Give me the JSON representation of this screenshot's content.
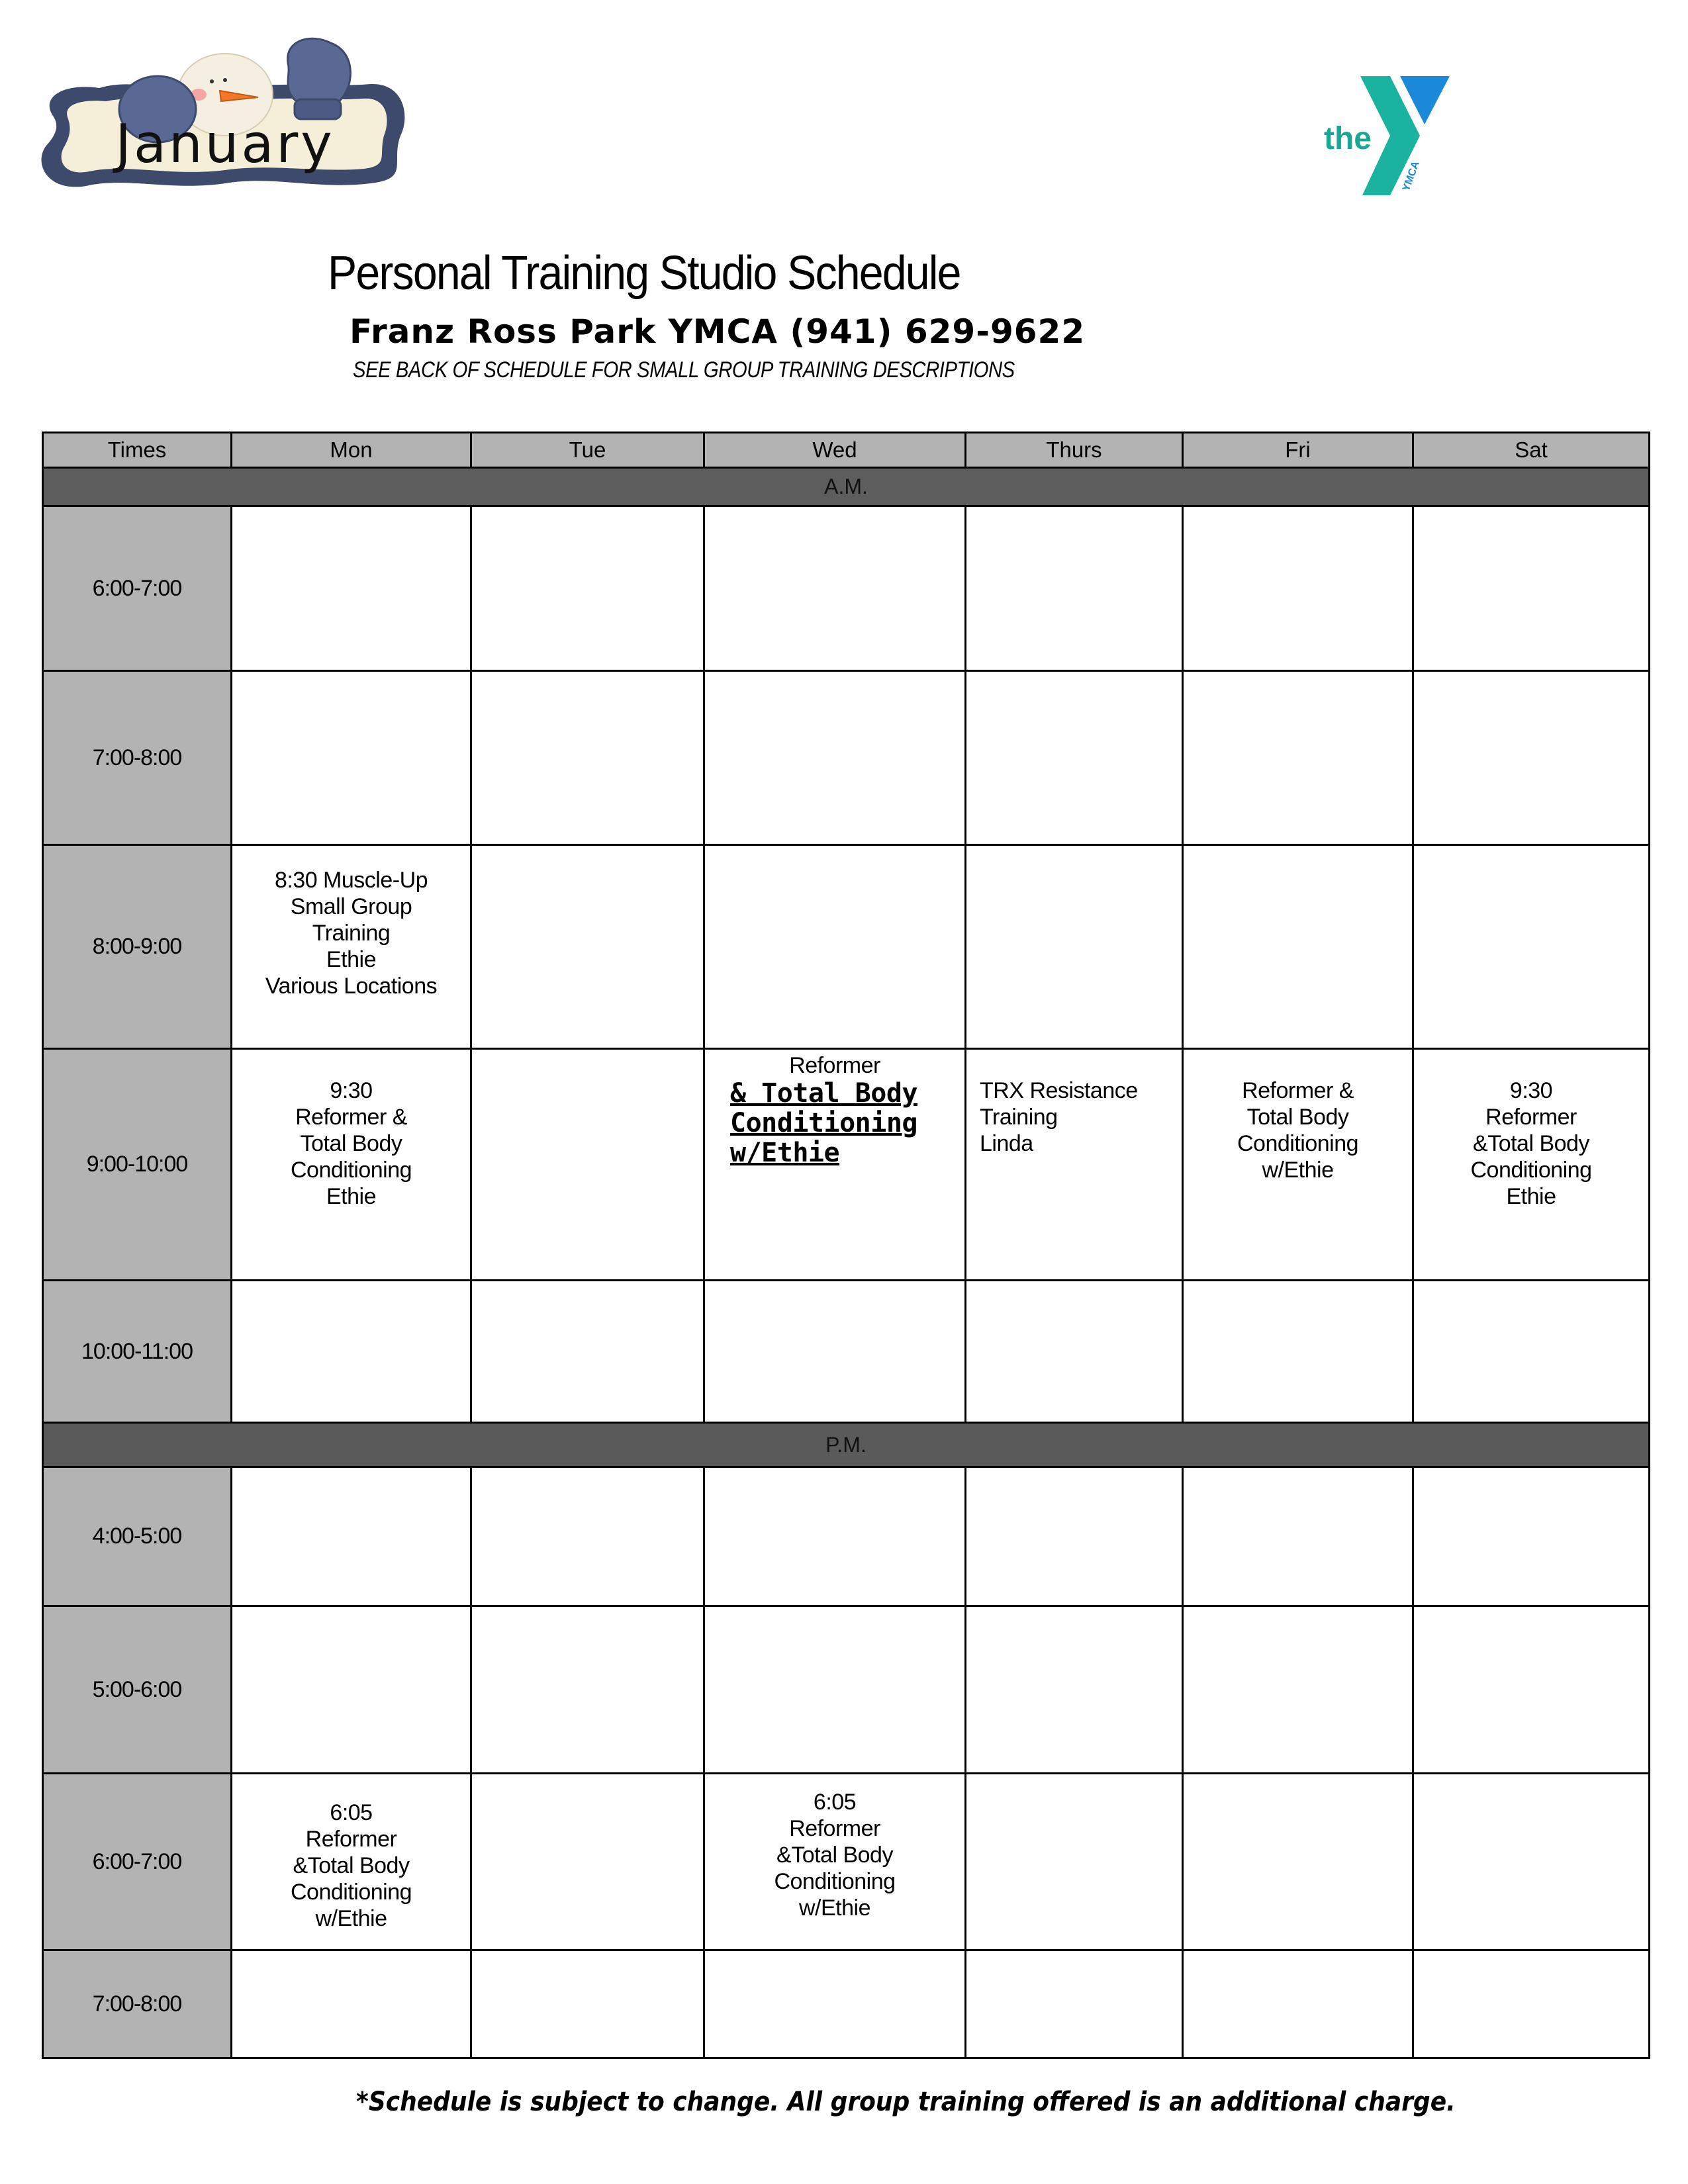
{
  "header": {
    "month_badge": "January",
    "ymca_logo_text": "the",
    "ymca_logo_subtext": "YMCA",
    "title": "Personal Training Studio Schedule",
    "location_phone": "Franz Ross Park YMCA (941) 629-9622",
    "see_back_note": "SEE BACK OF SCHEDULE FOR SMALL GROUP TRAINING DESCRIPTIONS"
  },
  "colors": {
    "header_gray": "#b3b3b3",
    "period_bar": "#5d5d5d",
    "ymca_teal": "#1db5a3",
    "ymca_blue": "#1a8ad8",
    "badge_navy": "#3d4a6b"
  },
  "schedule": {
    "columns": [
      "Times",
      "Mon",
      "Tue",
      "Wed",
      "Thurs",
      "Fri",
      "Sat"
    ],
    "am_label": "A.M.",
    "pm_label": "P.M.",
    "am_rows": [
      {
        "time": "6:00-7:00",
        "cells": [
          "",
          "",
          "",
          "",
          "",
          ""
        ]
      },
      {
        "time": "7:00-8:00",
        "cells": [
          "",
          "",
          "",
          "",
          "",
          ""
        ]
      },
      {
        "time": "8:00-9:00",
        "cells": [
          "8:30 Muscle-Up\nSmall Group\nTraining\nEthie\nVarious Locations",
          "",
          "",
          "",
          "",
          ""
        ]
      },
      {
        "time": "9:00-10:00",
        "cells": [
          "9:30\n  Reformer &\nTotal Body\nConditioning\n   Ethie",
          "",
          "Reformer",
          "TRX Resistance\n    Training\n      Linda",
          "  Reformer &\nTotal Body\nConditioning\n   w/Ethie",
          "9:30\nReformer\n&Total Body\nConditioning\nEthie"
        ],
        "wed_emphasis": "& Total Body\nConditioning\nw/Ethie"
      },
      {
        "time": "10:00-11:00",
        "cells": [
          "",
          "",
          "",
          "",
          "",
          ""
        ]
      }
    ],
    "pm_rows": [
      {
        "time": "4:00-5:00",
        "cells": [
          "",
          "",
          "",
          "",
          "",
          ""
        ]
      },
      {
        "time": "5:00-6:00",
        "cells": [
          "",
          "",
          "",
          "",
          "",
          ""
        ]
      },
      {
        "time": "6:00-7:00",
        "cells": [
          "6:05\nReformer\n&Total Body\nConditioning\nw/Ethie",
          "",
          "6:05\nReformer\n&Total Body\nConditioning\nw/Ethie",
          "",
          "",
          ""
        ]
      },
      {
        "time": "7:00-8:00",
        "cells": [
          "",
          "",
          "",
          "",
          "",
          ""
        ]
      }
    ]
  },
  "footer": {
    "note": "*Schedule is subject to change. All group training offered is an additional charge."
  }
}
